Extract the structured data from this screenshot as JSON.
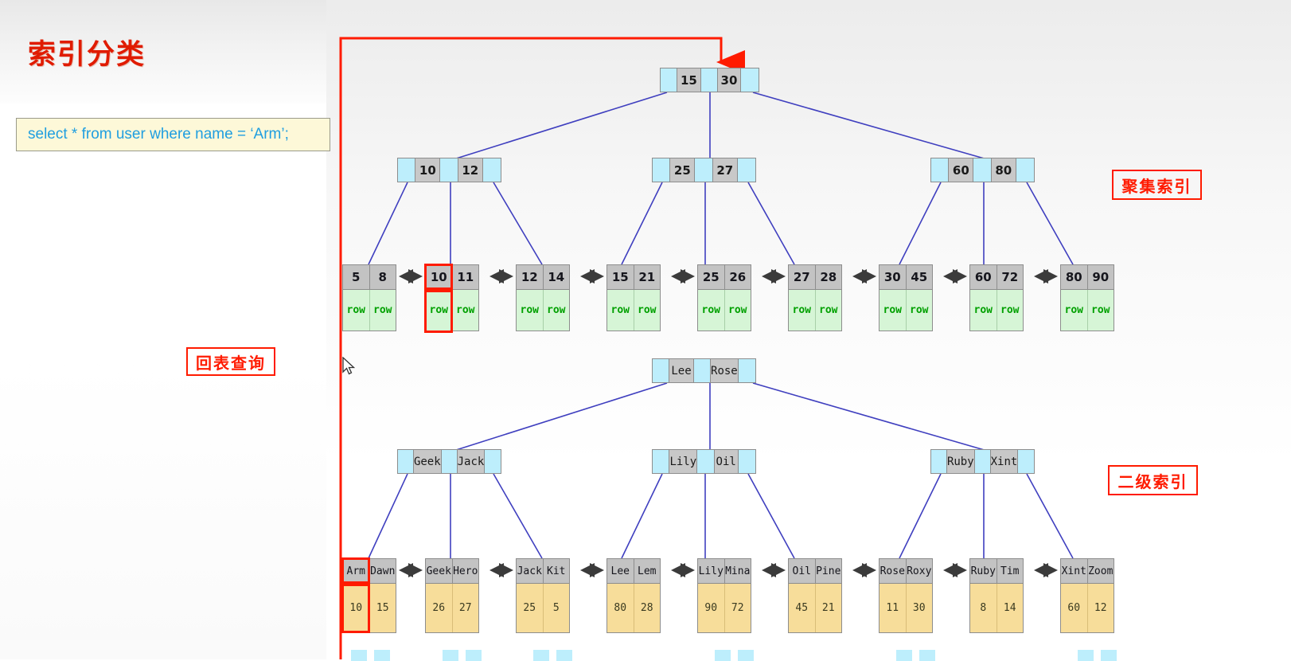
{
  "page_title": "索引分类",
  "sql": {
    "text": "select * from user where name = ‘Arm’;"
  },
  "callouts": {
    "back_table": "回表查询",
    "clustered": "聚集索引",
    "secondary": "二级索引"
  },
  "icons": {
    "cursor": "mouse-pointer-icon",
    "red_arrow": "red-down-arrow-icon",
    "sibling_link": "double-arrow-icon"
  },
  "colors": {
    "title": "#e01b00",
    "highlight": "#ff1b00",
    "pointer_cell": "#bdeefc",
    "key_cell": "#c8c8c8",
    "clustered_row_cell": "#d6f5d6",
    "clustered_row_text": "#00a000",
    "secondary_value_cell": "#f7dd9a",
    "sql_box_bg": "#fdf8d8",
    "sql_text": "#1f9ee0",
    "link_line": "#3f3fbf"
  },
  "clustered_index": {
    "root": {
      "keys": [
        "15",
        "30"
      ]
    },
    "level2": [
      {
        "keys": [
          "10",
          "12"
        ]
      },
      {
        "keys": [
          "25",
          "27"
        ]
      },
      {
        "keys": [
          "60",
          "80"
        ]
      }
    ],
    "leaves": [
      {
        "keys": [
          "5",
          "8"
        ],
        "rows": [
          "row",
          "row"
        ]
      },
      {
        "keys": [
          "10",
          "11"
        ],
        "rows": [
          "row",
          "row"
        ]
      },
      {
        "keys": [
          "12",
          "14"
        ],
        "rows": [
          "row",
          "row"
        ]
      },
      {
        "keys": [
          "15",
          "21"
        ],
        "rows": [
          "row",
          "row"
        ]
      },
      {
        "keys": [
          "25",
          "26"
        ],
        "rows": [
          "row",
          "row"
        ]
      },
      {
        "keys": [
          "27",
          "28"
        ],
        "rows": [
          "row",
          "row"
        ]
      },
      {
        "keys": [
          "30",
          "45"
        ],
        "rows": [
          "row",
          "row"
        ]
      },
      {
        "keys": [
          "60",
          "72"
        ],
        "rows": [
          "row",
          "row"
        ]
      },
      {
        "keys": [
          "80",
          "90"
        ],
        "rows": [
          "row",
          "row"
        ]
      }
    ],
    "highlighted_key": "10"
  },
  "secondary_index": {
    "root": {
      "keys": [
        "Lee",
        "Rose"
      ]
    },
    "level2": [
      {
        "keys": [
          "Geek",
          "Jack"
        ]
      },
      {
        "keys": [
          "Lily",
          "Oil"
        ]
      },
      {
        "keys": [
          "Ruby",
          "Xint"
        ]
      }
    ],
    "leaves": [
      {
        "keys": [
          "Arm",
          "Dawn"
        ],
        "values": [
          "10",
          "15"
        ]
      },
      {
        "keys": [
          "Geek",
          "Hero"
        ],
        "values": [
          "26",
          "27"
        ]
      },
      {
        "keys": [
          "Jack",
          "Kit"
        ],
        "values": [
          "25",
          "5"
        ]
      },
      {
        "keys": [
          "Lee",
          "Lem"
        ],
        "values": [
          "80",
          "28"
        ]
      },
      {
        "keys": [
          "Lily",
          "Mina"
        ],
        "values": [
          "90",
          "72"
        ]
      },
      {
        "keys": [
          "Oil",
          "Pine"
        ],
        "values": [
          "45",
          "21"
        ]
      },
      {
        "keys": [
          "Rose",
          "Roxy"
        ],
        "values": [
          "11",
          "30"
        ]
      },
      {
        "keys": [
          "Ruby",
          "Tim"
        ],
        "values": [
          "8",
          "14"
        ]
      },
      {
        "keys": [
          "Xint",
          "Zoom"
        ],
        "values": [
          "60",
          "12"
        ]
      }
    ],
    "highlighted_key": "Arm",
    "highlighted_value": "10"
  }
}
